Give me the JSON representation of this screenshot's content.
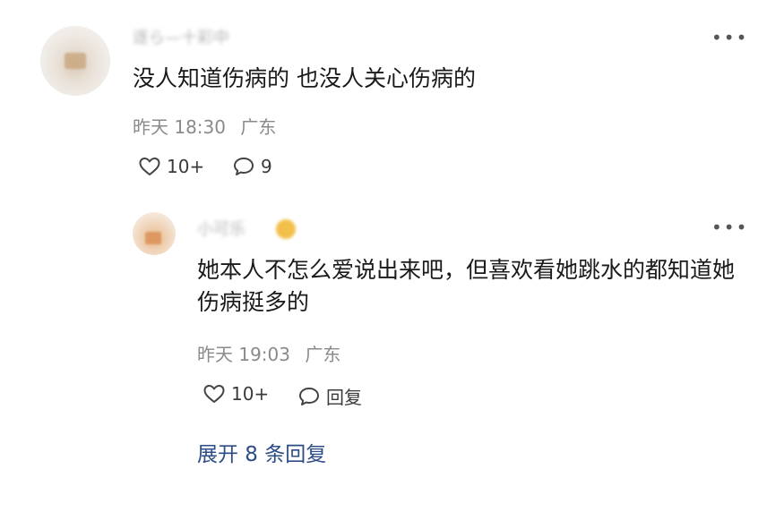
{
  "main_comment": {
    "username": "逐ら—十彩中",
    "text": "没人知道伤病的 也没人关心伤病的",
    "time": "昨天 18:30",
    "location": "广东",
    "likes": "10+",
    "replies_count": "9"
  },
  "reply": {
    "username": "小可乐",
    "text": "她本人不怎么爱说出来吧，但喜欢看她跳水的都知道她伤病挺多的",
    "time": "昨天 19:03",
    "location": "广东",
    "likes": "10+",
    "reply_label": "回复"
  },
  "expand_label": "展开 8 条回复",
  "icons": {
    "like": "heart-outline-icon",
    "comment": "speech-bubble-icon",
    "more": "more-dots-icon"
  },
  "colors": {
    "accent_link": "#2d4d86",
    "meta_text": "#8a8a8a",
    "body_text": "#1a1a1a"
  }
}
